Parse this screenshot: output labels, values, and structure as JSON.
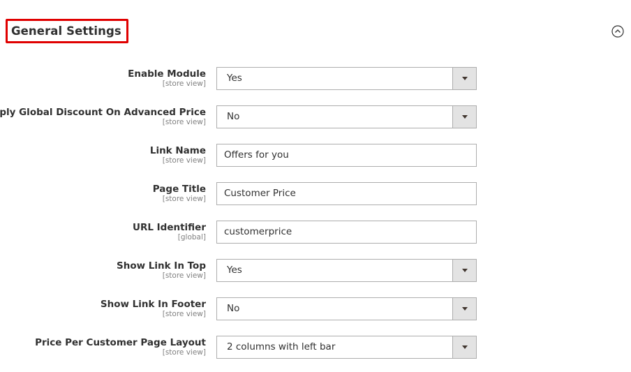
{
  "section": {
    "title": "General Settings",
    "collapse_icon": "chevron-up-circle-icon",
    "highlight_color": "#e00000"
  },
  "fields": [
    {
      "label": "Enable Module",
      "scope": "[store view]",
      "type": "select",
      "value": "Yes"
    },
    {
      "label": "Apply Global Discount On Advanced Price",
      "scope": "[store view]",
      "type": "select",
      "value": "No"
    },
    {
      "label": "Link Name",
      "scope": "[store view]",
      "type": "text",
      "value": "Offers for you"
    },
    {
      "label": "Page Title",
      "scope": "[store view]",
      "type": "text",
      "value": "Customer Price"
    },
    {
      "label": "URL Identifier",
      "scope": "[global]",
      "type": "text",
      "value": "customerprice"
    },
    {
      "label": "Show Link In Top",
      "scope": "[store view]",
      "type": "select",
      "value": "Yes"
    },
    {
      "label": "Show Link In Footer",
      "scope": "[store view]",
      "type": "select",
      "value": "No"
    },
    {
      "label": "Price Per Customer Page Layout",
      "scope": "[store view]",
      "type": "select",
      "value": "2 columns with left bar"
    }
  ]
}
